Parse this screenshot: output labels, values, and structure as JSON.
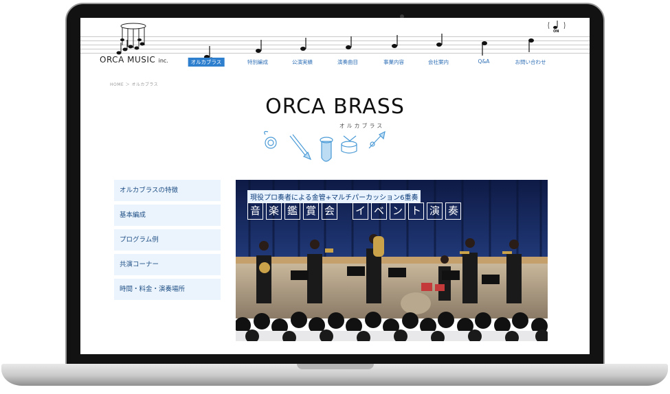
{
  "header": {
    "logo_name": "ORCA MUSIC",
    "logo_suffix": "inc.",
    "nav": [
      {
        "label": "オルカブラス",
        "active": true
      },
      {
        "label": "特別編成",
        "active": false
      },
      {
        "label": "公演実績",
        "active": false
      },
      {
        "label": "演奏曲目",
        "active": false
      },
      {
        "label": "事業内容",
        "active": false
      },
      {
        "label": "会社案内",
        "active": false
      },
      {
        "label": "Q&A",
        "active": false
      },
      {
        "label": "お問い合わせ",
        "active": false
      }
    ],
    "sound_toggle": "ON"
  },
  "breadcrumb": "HOME ＞ オルカブラス",
  "brand": {
    "title": "ORCA BRASS",
    "subtitle": "オルカブラス"
  },
  "side_menu": [
    "オルカブラスの特徴",
    "基本編成",
    "プログラム例",
    "共演コーナー",
    "時間・料金・演奏場所"
  ],
  "hero": {
    "tagline": "現役プロ奏者による金管+マルチパーカッション6重奏",
    "group1": [
      "音",
      "楽",
      "鑑",
      "賞",
      "会"
    ],
    "group2": [
      "イ",
      "ベ",
      "ン",
      "ト",
      "演",
      "奏"
    ]
  },
  "colors": {
    "accent": "#2f7fcf",
    "menu_bg": "#ebf4fc",
    "menu_text": "#1f4f86",
    "instrument": "#4a9ad6"
  },
  "icons": [
    "music-note-icon",
    "french-horn-icon",
    "trombone-icon",
    "tuba-icon",
    "snare-drum-icon",
    "trumpet-icon"
  ]
}
